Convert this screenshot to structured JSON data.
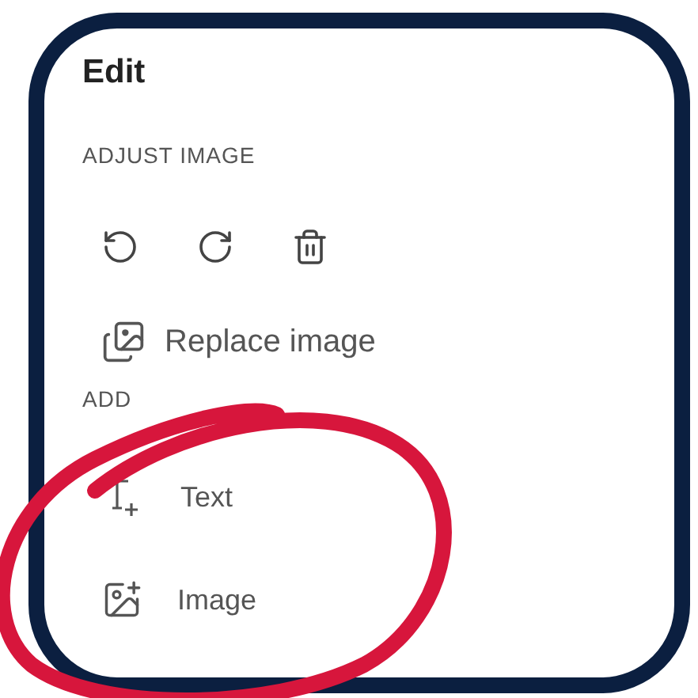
{
  "panel": {
    "title": "Edit"
  },
  "adjust_image": {
    "header": "ADJUST IMAGE",
    "tools": [
      {
        "kind": "undo"
      },
      {
        "kind": "redo"
      },
      {
        "kind": "delete"
      }
    ],
    "action": {
      "label": "Replace image"
    }
  },
  "add_content": {
    "header": "ADD",
    "items": [
      {
        "kind": "text",
        "label": "Text"
      },
      {
        "kind": "image",
        "label": "Image"
      }
    ]
  }
}
